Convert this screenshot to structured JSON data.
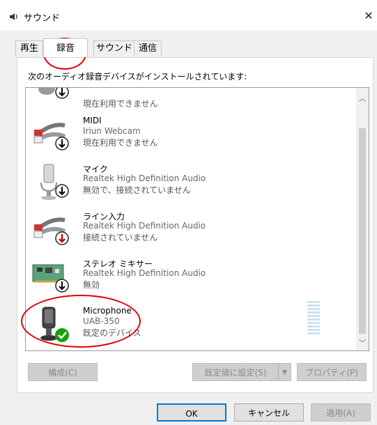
{
  "window": {
    "title": "サウンド",
    "close_glyph": "✕"
  },
  "tabs": [
    {
      "label": "再生",
      "active": false
    },
    {
      "label": "録音",
      "active": true
    },
    {
      "label": "サウンド",
      "active": false
    },
    {
      "label": "通信",
      "active": false
    }
  ],
  "description": "次のオーディオ録音デバイスがインストールされています:",
  "devices": [
    {
      "name": "",
      "sub1": "",
      "sub2": "現在利用できません",
      "icon": "cable-icon",
      "status": "down-arrow"
    },
    {
      "name": "MIDI",
      "sub1": "Iriun Webcam",
      "sub2": "現在利用できません",
      "icon": "rca-cable-icon",
      "status": "down-arrow"
    },
    {
      "name": "マイク",
      "sub1": "Realtek High Definition Audio",
      "sub2": "無効で、接続されていません",
      "icon": "microphone-icon",
      "status": "down-arrow"
    },
    {
      "name": "ライン入力",
      "sub1": "Realtek High Definition Audio",
      "sub2": "接続されていません",
      "icon": "rca-cable-icon",
      "status": "red-down-arrow"
    },
    {
      "name": "ステレオ ミキサー",
      "sub1": "Realtek High Definition Audio",
      "sub2": "無効",
      "icon": "circuit-board-icon",
      "status": "down-arrow"
    },
    {
      "name": "Microphone",
      "sub1": "UAB-350",
      "sub2": "既定のデバイス",
      "icon": "usb-microphone-icon",
      "status": "green-check"
    }
  ],
  "buttons": {
    "configure": "構成(C)",
    "set_default": "既定値に設定(S)",
    "properties": "プロパティ(P)",
    "ok": "OK",
    "cancel": "キャンセル",
    "apply": "適用(A)"
  },
  "colors": {
    "highlight_circle": "#e00000",
    "default_button_border": "#0078d7",
    "status_green": "#13a10e",
    "status_red": "#d00000"
  }
}
